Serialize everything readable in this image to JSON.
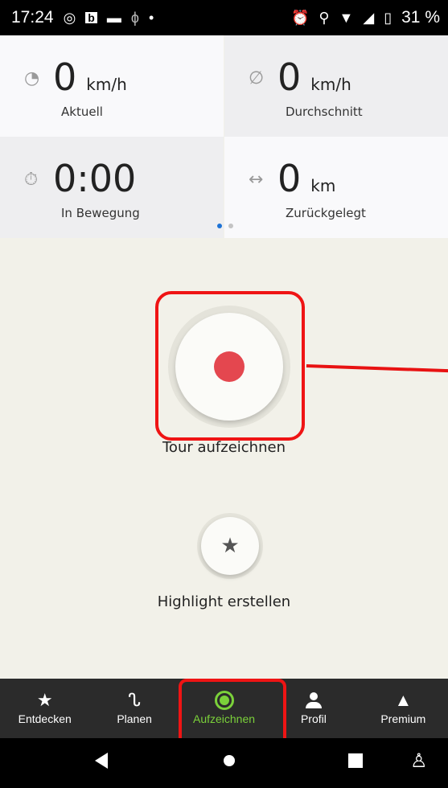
{
  "status_bar": {
    "time": "17:24",
    "battery": "31 %",
    "icons_left": [
      "whatsapp-icon",
      "b-app-icon",
      "minus-icon",
      "bike-icon",
      "dot-icon"
    ],
    "icons_right": [
      "alarm-icon",
      "location-icon",
      "wifi-icon",
      "signal-icon",
      "battery-icon"
    ]
  },
  "stats": [
    {
      "icon": "speedometer-icon",
      "value": "0",
      "unit": "km/h",
      "label": "Aktuell"
    },
    {
      "icon": "average-icon",
      "value": "0",
      "unit": "km/h",
      "label": "Durchschnitt"
    },
    {
      "icon": "stopwatch-icon",
      "value": "0:00",
      "unit": "",
      "label": "In Bewegung"
    },
    {
      "icon": "distance-arrows-icon",
      "value": "0",
      "unit": "km",
      "label": "Zurückgelegt"
    }
  ],
  "page_indicator": {
    "count": 2,
    "active": 0
  },
  "record": {
    "label": "Tour aufzeichnen"
  },
  "highlight": {
    "label": "Highlight erstellen"
  },
  "bottom_nav": [
    {
      "label": "Entdecken",
      "icon": "star-icon",
      "active": false
    },
    {
      "label": "Planen",
      "icon": "route-icon",
      "active": false
    },
    {
      "label": "Aufzeichnen",
      "icon": "record-icon",
      "active": true
    },
    {
      "label": "Profil",
      "icon": "person-icon",
      "active": false
    },
    {
      "label": "Premium",
      "icon": "premium-icon",
      "active": false
    }
  ],
  "colors": {
    "accent_green": "#7bd13a",
    "record_red": "#e4474f",
    "annotation_red": "#ef1414",
    "page_dot_active": "#1e73d6"
  }
}
